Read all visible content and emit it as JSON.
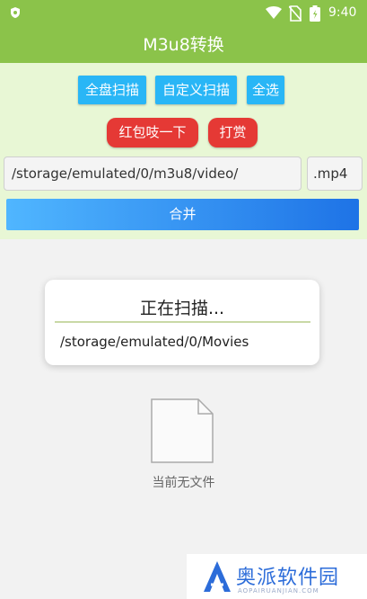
{
  "statusbar": {
    "time": "9:40"
  },
  "app": {
    "title": "M3u8转换"
  },
  "buttons": {
    "scan_all": "全盘扫描",
    "custom_scan": "自定义扫描",
    "select_all": "全选",
    "red_packet": "红包吱一下",
    "tip": "打赏",
    "merge": "合并"
  },
  "inputs": {
    "path": "/storage/emulated/0/m3u8/video/",
    "extension": ".mp4"
  },
  "dialog": {
    "title": "正在扫描...",
    "path": "/storage/emulated/0/Movies"
  },
  "empty": {
    "label": "当前无文件"
  },
  "watermark": {
    "text": "奥派软件园",
    "sub": "AOPAIRUANJIAN.COM"
  },
  "colors": {
    "appbar": "#8bc34a",
    "button_blue": "#29b6f6",
    "button_red": "#e53935",
    "merge_start": "#50b6ff",
    "merge_end": "#1e73e6"
  }
}
